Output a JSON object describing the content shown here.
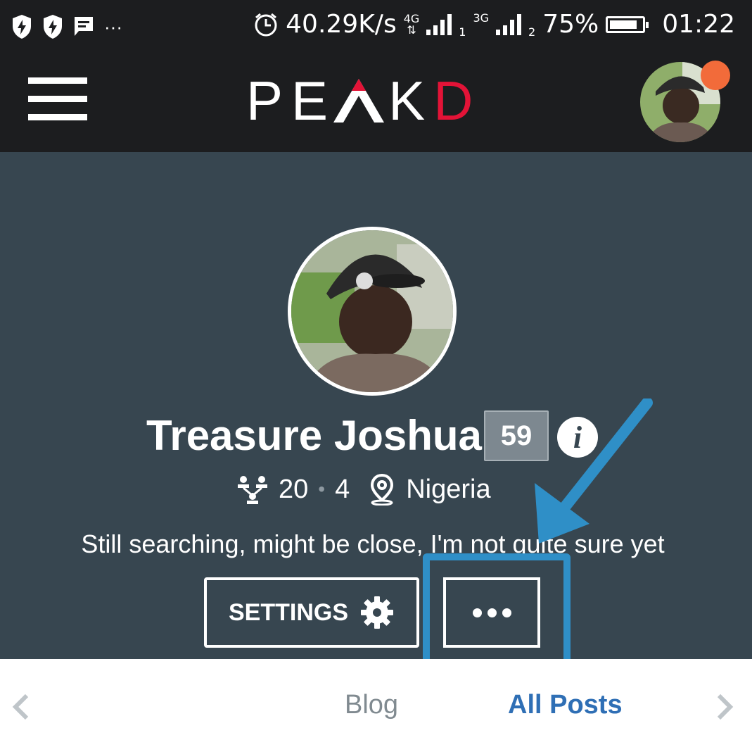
{
  "status_bar": {
    "left_icons": [
      "shield-bolt-icon",
      "shield-bolt-icon",
      "message-icon",
      "more-icon"
    ],
    "more_label": "···",
    "net_speed": "40.29K/s",
    "net1": "4G",
    "net1_slot": "1",
    "net2": "3G",
    "net2_slot": "2",
    "battery": "75%",
    "battery_level": 0.75,
    "time": "01:22"
  },
  "navbar": {
    "logo": "PEAKD",
    "logo_main": "PE",
    "logo_tail": "KD",
    "logo_d": "D",
    "brand_color": "#e31337",
    "notification_color": "#f26b3a"
  },
  "profile": {
    "name": "Treasure Joshua",
    "reputation": "59",
    "info_label": "i",
    "followers": "20",
    "following": "4",
    "separator": "•",
    "location": "Nigeria",
    "bio": "Still searching, might be close, I'm not quite sure yet",
    "settings_label": "SETTINGS",
    "accent_color": "#2f8fc7"
  },
  "tabs": {
    "items": [
      "Blog",
      "All Posts"
    ],
    "active": "All Posts"
  }
}
